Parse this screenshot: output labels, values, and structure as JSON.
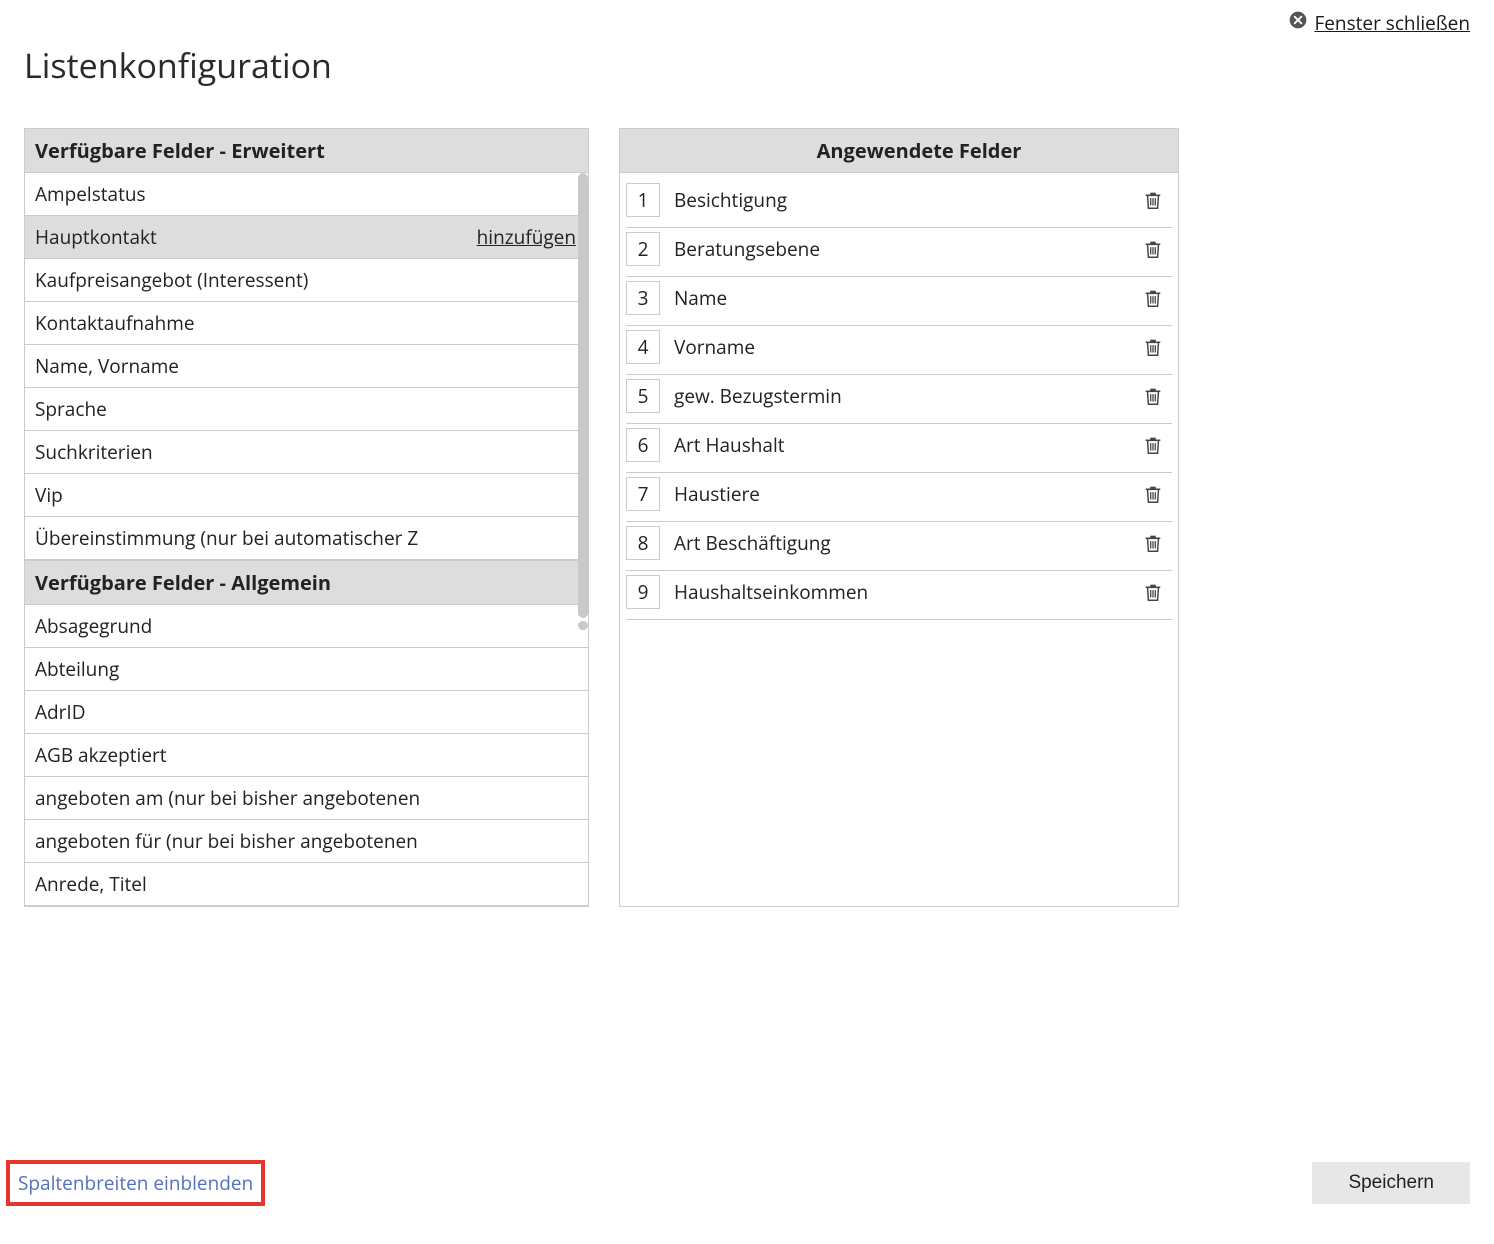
{
  "close_window": "Fenster schließen",
  "page_title": "Listenkonfiguration",
  "add_label": "hinzufügen",
  "available": {
    "extended_header": "Verfügbare Felder - Erweitert",
    "extended": [
      {
        "label": "Ampelstatus",
        "hover": false
      },
      {
        "label": "Hauptkontakt",
        "hover": true
      },
      {
        "label": "Kaufpreisangebot (Interessent)",
        "hover": false
      },
      {
        "label": "Kontaktaufnahme",
        "hover": false
      },
      {
        "label": "Name, Vorname",
        "hover": false
      },
      {
        "label": "Sprache",
        "hover": false
      },
      {
        "label": "Suchkriterien",
        "hover": false
      },
      {
        "label": "Vip",
        "hover": false
      },
      {
        "label": "Übereinstimmung (nur bei automatischer Z",
        "hover": false
      }
    ],
    "general_header": "Verfügbare Felder - Allgemein",
    "general": [
      {
        "label": "Absagegrund"
      },
      {
        "label": "Abteilung"
      },
      {
        "label": "AdrID"
      },
      {
        "label": "AGB akzeptiert"
      },
      {
        "label": "angeboten am (nur bei bisher angebotenen"
      },
      {
        "label": "angeboten für (nur bei bisher angebotenen"
      },
      {
        "label": "Anrede, Titel"
      }
    ]
  },
  "applied": {
    "header": "Angewendete Felder",
    "items": [
      {
        "order": "1",
        "label": "Besichtigung"
      },
      {
        "order": "2",
        "label": "Beratungsebene"
      },
      {
        "order": "3",
        "label": "Name"
      },
      {
        "order": "4",
        "label": "Vorname"
      },
      {
        "order": "5",
        "label": "gew. Bezugstermin"
      },
      {
        "order": "6",
        "label": "Art Haushalt"
      },
      {
        "order": "7",
        "label": "Haustiere"
      },
      {
        "order": "8",
        "label": "Art Beschäftigung"
      },
      {
        "order": "9",
        "label": "Haushaltseinkommen"
      }
    ]
  },
  "footer": {
    "show_widths": "Spaltenbreiten einblenden",
    "save": "Speichern"
  }
}
